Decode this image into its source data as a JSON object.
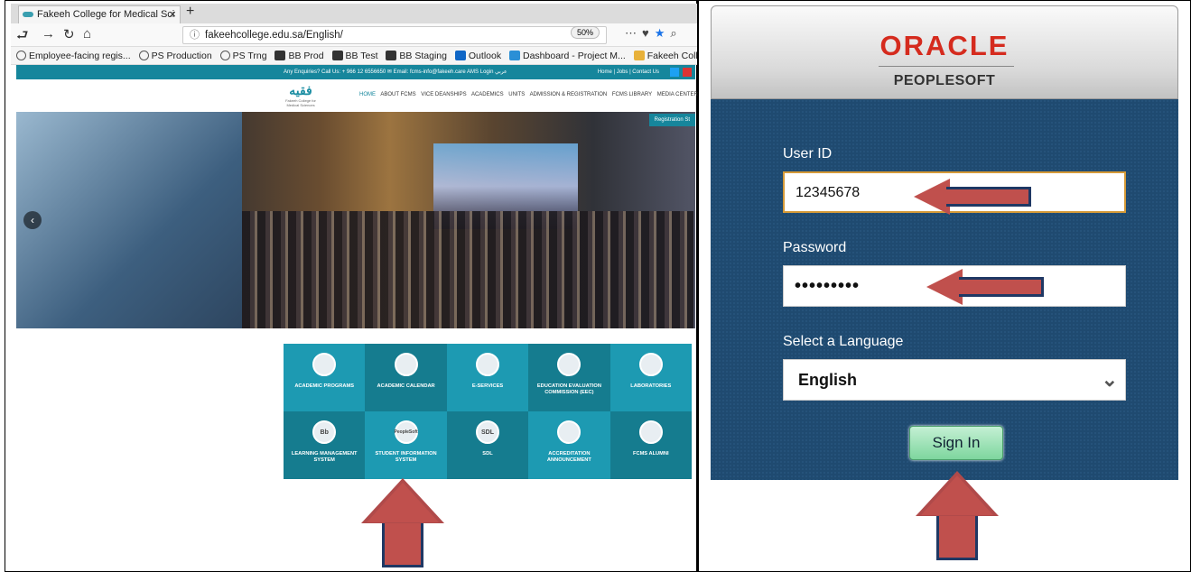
{
  "browser": {
    "tab_title": "Fakeeh College for Medical Sci",
    "tab_close": "×",
    "new_tab": "+",
    "url": "fakeehcollege.edu.sa/English/",
    "zoom": "50%",
    "bookmarks": [
      "Employee-facing regis...",
      "PS Production",
      "PS Trng",
      "BB Prod",
      "BB Test",
      "BB Staging",
      "Outlook",
      "Dashboard - Project M...",
      "Fakeeh College for Me..."
    ]
  },
  "site": {
    "topbar_left": "Any Enquiries? Call Us: + 966 12 6556650   ✉ Email: fcms-info@fakeeh.care   AMS Login   عربي",
    "topbar_right": "Home  |  Jobs  |  Contact Us",
    "logo": "فقيه",
    "logo_sub": "Fakeeh College for Medical Sciences",
    "menu": [
      "HOME",
      "ABOUT FCMS",
      "VICE DEANSHIPS",
      "ACADEMICS",
      "UNITS",
      "ADMISSION & REGISTRATION",
      "FCMS LIBRARY",
      "MEDIA CENTER"
    ],
    "hero_button": "Registration St",
    "tiles": [
      {
        "label": "ACADEMIC PROGRAMS",
        "icon": ""
      },
      {
        "label": "ACADEMIC CALENDAR",
        "icon": ""
      },
      {
        "label": "E-SERVICES",
        "icon": ""
      },
      {
        "label": "EDUCATION EVALUATION COMMISSION (EEC)",
        "icon": ""
      },
      {
        "label": "LABORATORIES",
        "icon": ""
      },
      {
        "label": "LEARNING MANAGEMENT SYSTEM",
        "icon": "Bb"
      },
      {
        "label": "STUDENT INFORMATION SYSTEM",
        "icon": "PeopleSoft"
      },
      {
        "label": "SDL",
        "icon": "SDL"
      },
      {
        "label": "ACCREDITATION ANNOUNCEMENT",
        "icon": ""
      },
      {
        "label": "FCMS ALUMNI",
        "icon": ""
      }
    ]
  },
  "peoplesoft": {
    "brand": "ORACLE",
    "product": "PEOPLESOFT",
    "user_id_label": "User ID",
    "user_id_value": "12345678",
    "password_label": "Password",
    "password_value": "•••••••••",
    "language_label": "Select a Language",
    "language_value": "English",
    "sign_in": "Sign In"
  },
  "colors": {
    "site_teal": "#16869c",
    "oracle_red": "#d52b1e",
    "ps_blue": "#1f4a70",
    "arrow_red": "#c0504d",
    "signin_green": "#7ed69e"
  }
}
